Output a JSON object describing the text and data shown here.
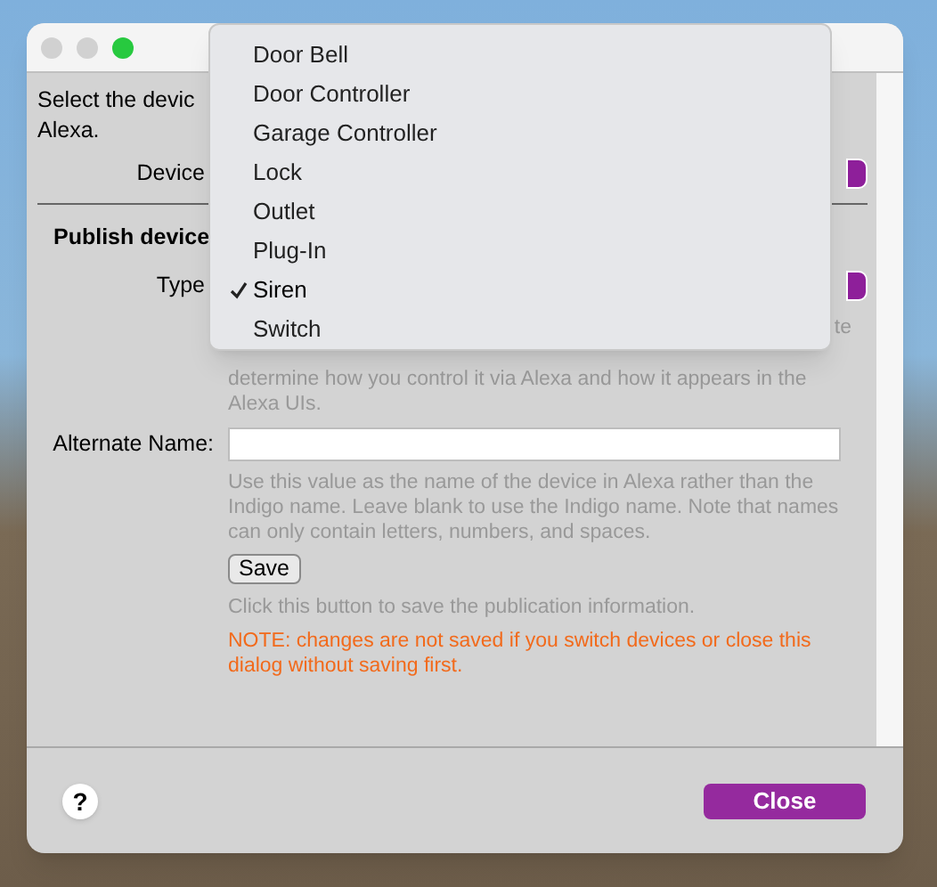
{
  "window": {
    "buttons": [
      {
        "color": "#d1d1d1"
      },
      {
        "color": "#d1d1d1"
      },
      {
        "color": "#27c93f"
      }
    ]
  },
  "intro": [
    "Select the devic",
    "Alexa."
  ],
  "device_row": {
    "label": "Device"
  },
  "section_title": "Publish device",
  "type_row": {
    "label": "Type"
  },
  "type_help_fragment": "te",
  "type_help": [
    "determine how you control it via Alexa and how it appears in the",
    "Alexa UIs."
  ],
  "alternate_name": {
    "label": "Alternate Name:",
    "help": [
      "Use this value as the name of the device in Alexa rather than the",
      "Indigo name. Leave blank to use the Indigo name. Note that names",
      "can only contain letters, numbers, and spaces."
    ]
  },
  "save_button": "Save",
  "save_help": "Click this button to save the publication information.",
  "note": [
    "NOTE: changes are not saved if you switch devices or close this",
    "dialog without saving first."
  ],
  "help_button": "?",
  "close_button": "Close",
  "menu": {
    "items": [
      {
        "label": "Door Bell",
        "selected": false
      },
      {
        "label": "Door Controller",
        "selected": false
      },
      {
        "label": "Garage Controller",
        "selected": false
      },
      {
        "label": "Lock",
        "selected": false
      },
      {
        "label": "Outlet",
        "selected": false
      },
      {
        "label": "Plug-In",
        "selected": false
      },
      {
        "label": "Siren",
        "selected": true
      },
      {
        "label": "Switch",
        "selected": false
      }
    ]
  }
}
